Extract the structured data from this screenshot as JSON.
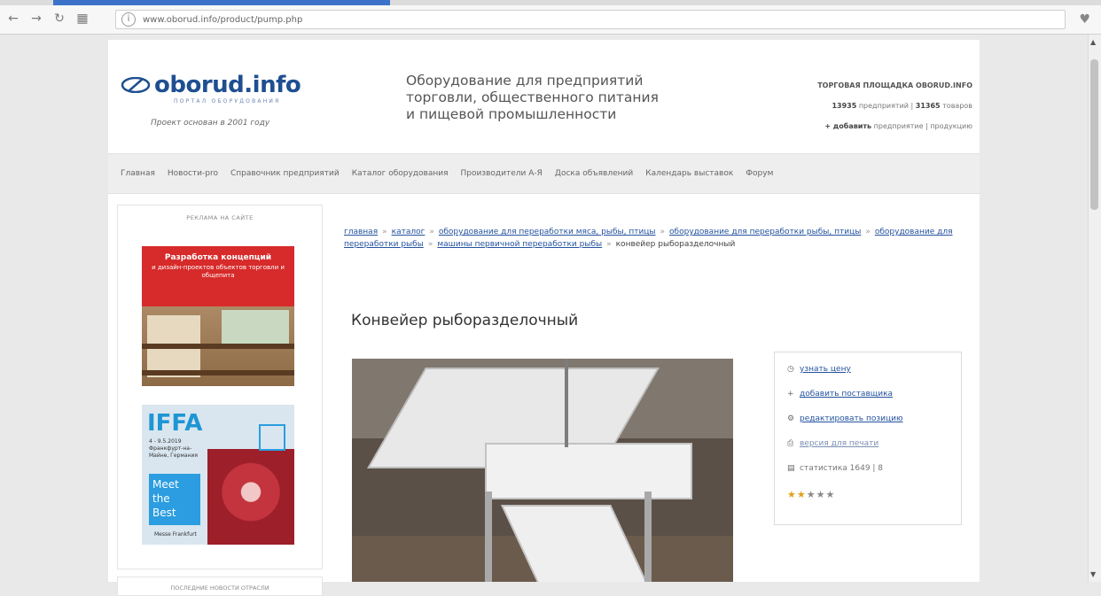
{
  "browser": {
    "url": "www.oborud.info/product/pump.php",
    "icons": [
      "back-icon",
      "forward-icon",
      "reload-icon",
      "apps-icon",
      "info-icon",
      "heart-icon"
    ]
  },
  "header": {
    "logo_name": "oborud.info",
    "logo_sub": "ПОРТАЛ ОБОРУДОВАНИЯ",
    "logo_since": "Проект основан в 2001 году",
    "tagline_line1": "Оборудование для предприятий",
    "tagline_line2": "торговли, общественного питания",
    "tagline_line3": "и пищевой промышленности",
    "stats_title": "ТОРГОВАЯ ПЛОЩАДКА OBORUD.INFO",
    "stats_companies_count": "13935",
    "stats_companies_label": "предприятий",
    "stats_products_count": "31365",
    "stats_products_label": "товаров",
    "stats_add_prefix": "+ добавить",
    "stats_add_link1": "предприятие",
    "stats_add_link2": "продукцию"
  },
  "menu": [
    "Главная",
    "Новости-pro",
    "Справочник предприятий",
    "Каталог оборудования",
    "Производители А-Я",
    "Доска объявлений",
    "Календарь выставок",
    "Форум"
  ],
  "left": {
    "ad_heading": "РЕКЛАМА НА САЙТЕ",
    "ad1_title": "Разработка концепций",
    "ad1_text": "и дизайн-проектов объектов торговли и общепита",
    "ad2_brand": "IFFA",
    "ad2_small": "4 - 9.5.2019 Франкфурт-на-Майне, Германия",
    "ad2_meet": "Meet the Best",
    "ad2_logo": "Messe Frankfurt",
    "bottom_heading": "ПОСЛЕДНИЕ НОВОСТИ ОТРАСЛИ"
  },
  "breadcrumb": {
    "items": [
      "главная",
      "каталог",
      "оборудование для переработки мяса, рыбы, птицы",
      "оборудование для переработки рыбы, птицы",
      "оборудование для переработки рыбы",
      "машины первичной переработки рыбы"
    ],
    "separator": "»",
    "current": "конвейер рыборазделочный"
  },
  "product": {
    "title": "Конвейер рыборазделочный"
  },
  "sidebox": {
    "price_link": "узнать цену",
    "add_supplier": "добавить поставщика",
    "edit_position": "редактировать позицию",
    "print_version": "версия для печати",
    "stats_text": "статистика 1649 | 8",
    "rating_value": 2,
    "rating_max": 5
  },
  "colors": {
    "brand": "#1f4f91",
    "link": "#24539e",
    "ad_red": "#d72a2a",
    "star": "#e0a21c"
  }
}
